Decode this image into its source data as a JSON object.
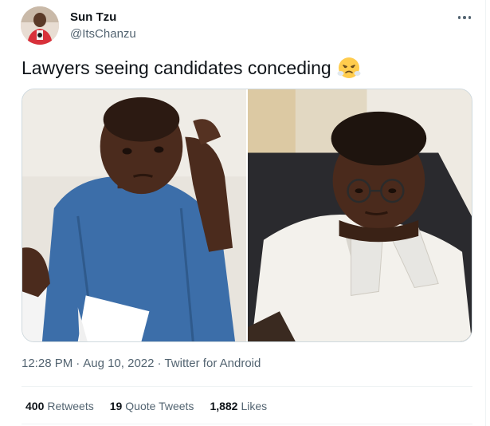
{
  "author": {
    "display_name": "Sun Tzu",
    "handle": "@ItsChanzu"
  },
  "tweet": {
    "text": "Lawyers seeing candidates conceding",
    "emoji": "face-with-steam-from-nose-icon"
  },
  "meta": {
    "time": "12:28 PM",
    "separator": "·",
    "date": "Aug 10, 2022",
    "source": "Twitter for Android"
  },
  "stats": {
    "retweets_count": "400",
    "retweets_label": "Retweets",
    "quotes_count": "19",
    "quotes_label": "Quote Tweets",
    "likes_count": "1,882",
    "likes_label": "Likes"
  },
  "colors": {
    "text_primary": "#0f1419",
    "text_secondary": "#536471",
    "border": "#cfd9de",
    "divider": "#eff3f4"
  }
}
